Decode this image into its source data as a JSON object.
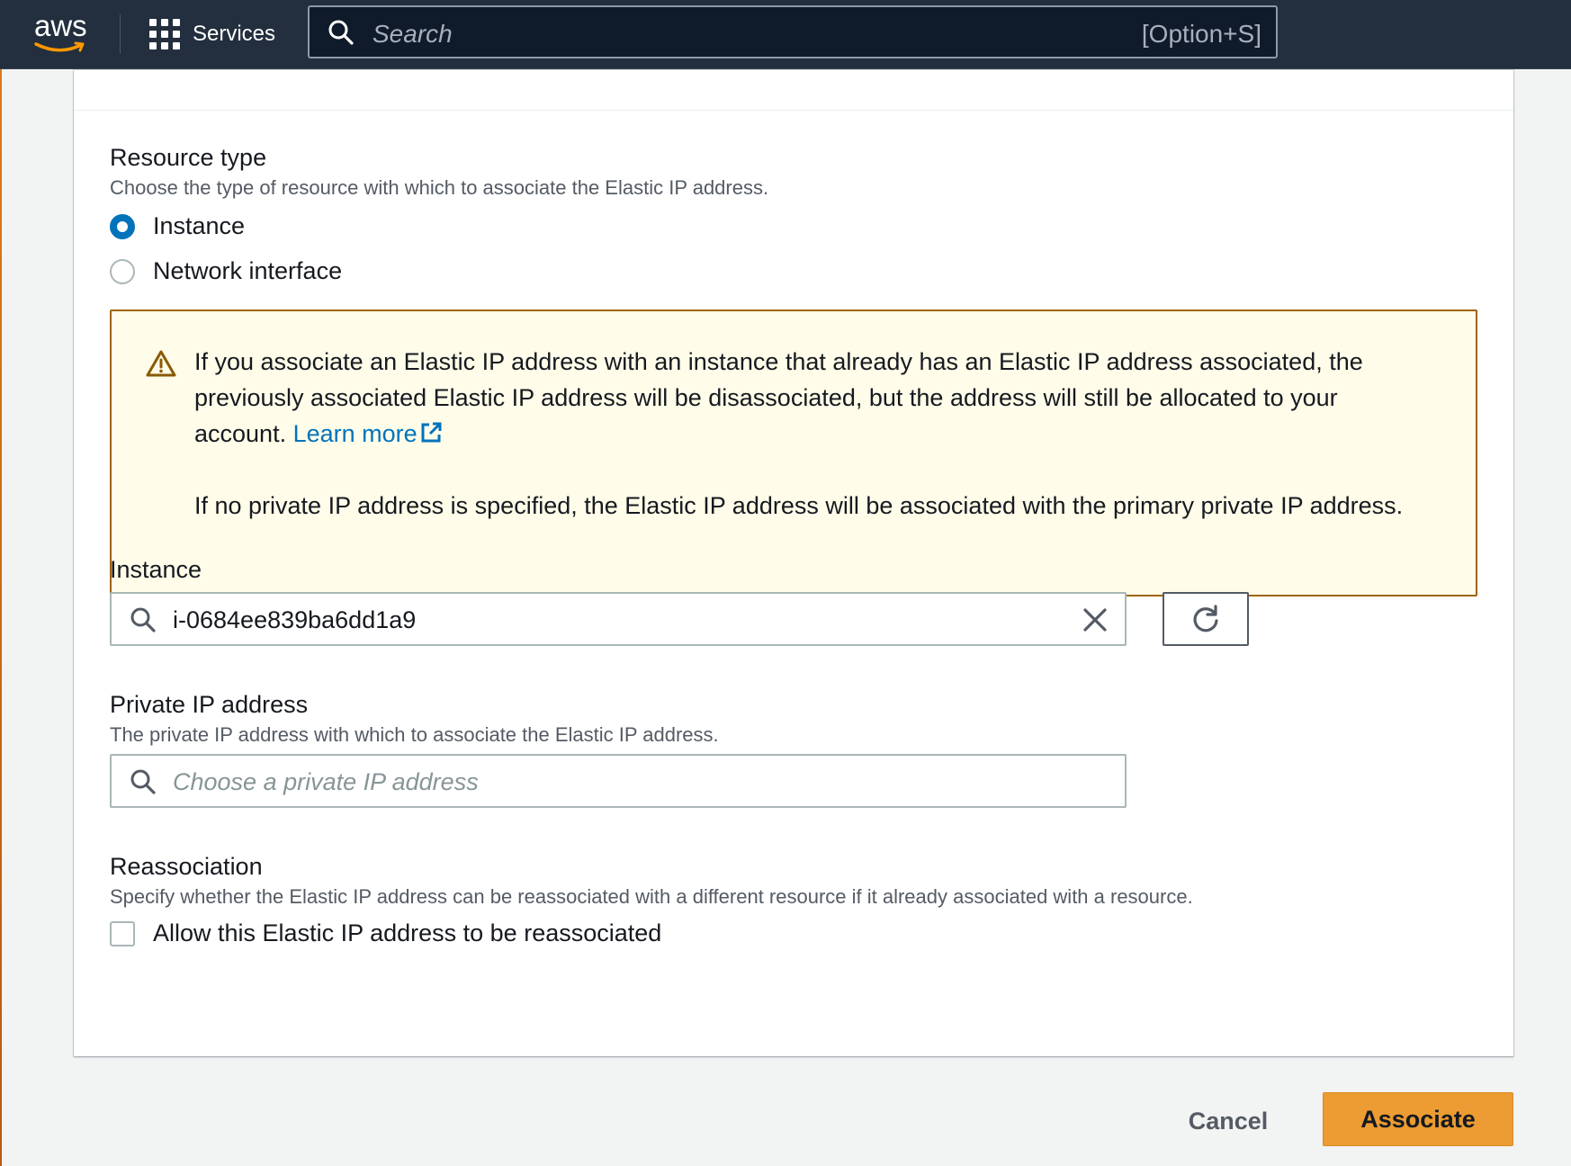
{
  "topnav": {
    "logo_text": "aws",
    "services_label": "Services",
    "search_placeholder": "Search",
    "search_shortcut": "[Option+S]"
  },
  "resource_type": {
    "label": "Resource type",
    "description": "Choose the type of resource with which to associate the Elastic IP address.",
    "options": [
      {
        "label": "Instance",
        "selected": true
      },
      {
        "label": "Network interface",
        "selected": false
      }
    ]
  },
  "alert": {
    "paragraph1_text": "If you associate an Elastic IP address with an instance that already has an Elastic IP address associated, the previously associated Elastic IP address will be disassociated, but the address will still be allocated to your account.",
    "learn_more": "Learn more",
    "paragraph2_text": "If no private IP address is specified, the Elastic IP address will be associated with the primary private IP address."
  },
  "instance": {
    "label": "Instance",
    "value": "i-0684ee839ba6dd1a9"
  },
  "private_ip": {
    "label": "Private IP address",
    "description": "The private IP address with which to associate the Elastic IP address.",
    "placeholder": "Choose a private IP address"
  },
  "reassociation": {
    "label": "Reassociation",
    "description": "Specify whether the Elastic IP address can be reassociated with a different resource if it already associated with a resource.",
    "checkbox_label": "Allow this Elastic IP address to be reassociated",
    "checked": false
  },
  "actions": {
    "cancel_label": "Cancel",
    "associate_label": "Associate"
  },
  "colors": {
    "nav_bg": "#232f3e",
    "primary_button": "#ec9c33",
    "link": "#0073bb",
    "alert_bg": "#fffce9",
    "alert_border": "#9d6600"
  }
}
